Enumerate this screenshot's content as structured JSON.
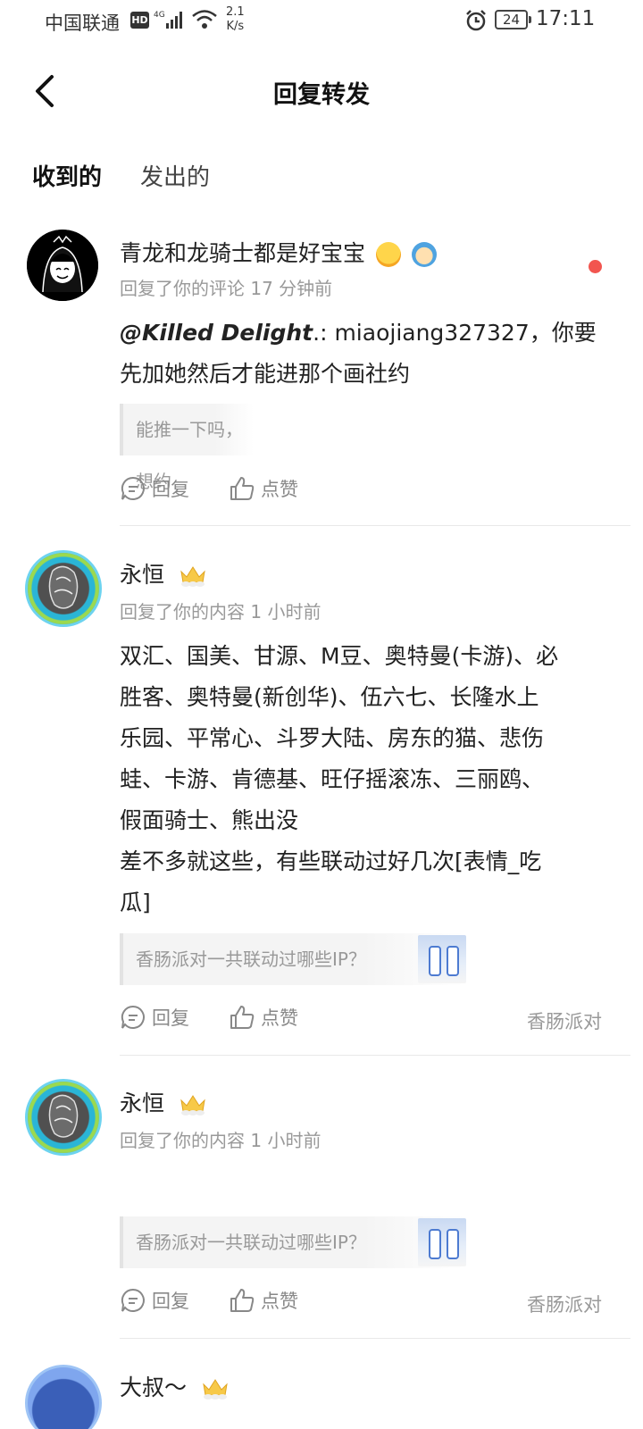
{
  "status_bar": {
    "carrier": "中国联通",
    "hd": "HD",
    "net_type": "4G",
    "speed_value": "2.1",
    "speed_unit": "K/s",
    "battery": "24",
    "time": "17:11"
  },
  "header": {
    "title": "回复转发"
  },
  "tabs": {
    "received": "收到的",
    "sent": "发出的"
  },
  "actions": {
    "reply": "回复",
    "like": "点赞"
  },
  "items": [
    {
      "username": "青龙和龙骑士都是好宝宝",
      "meta": "回复了你的评论 17 分钟前",
      "mention": "@Killed Delight",
      "content": ".: miaojiang327327，你要先加她然后才能进那个画社约",
      "quote": "能推一下吗，想约",
      "unread": true
    },
    {
      "username": "永恒",
      "meta": "回复了你的内容 1 小时前",
      "content_lines": [
        "双汇、国美、甘源、M豆、奥特曼(卡游)、必",
        "胜客、奥特曼(新创华)、伍六七、长隆水上",
        "乐园、平常心、斗罗大陆、房东的猫、悲伤",
        "蛙、卡游、肯德基、旺仔摇滚冻、三丽鸥、",
        "假面骑士、熊出没",
        "差不多就这些，有些联动过好几次[表情_吃",
        "瓜]"
      ],
      "quote": "香肠派对一共联动过哪些IP？",
      "source": "香肠派对"
    },
    {
      "username": "永恒",
      "meta": "回复了你的内容 1 小时前",
      "quote": "香肠派对一共联动过哪些IP？",
      "source": "香肠派对"
    },
    {
      "username": "大叔～"
    }
  ],
  "colors": {
    "accent": "#3ad3c2",
    "unread": "#f2554f",
    "muted": "#999999"
  }
}
